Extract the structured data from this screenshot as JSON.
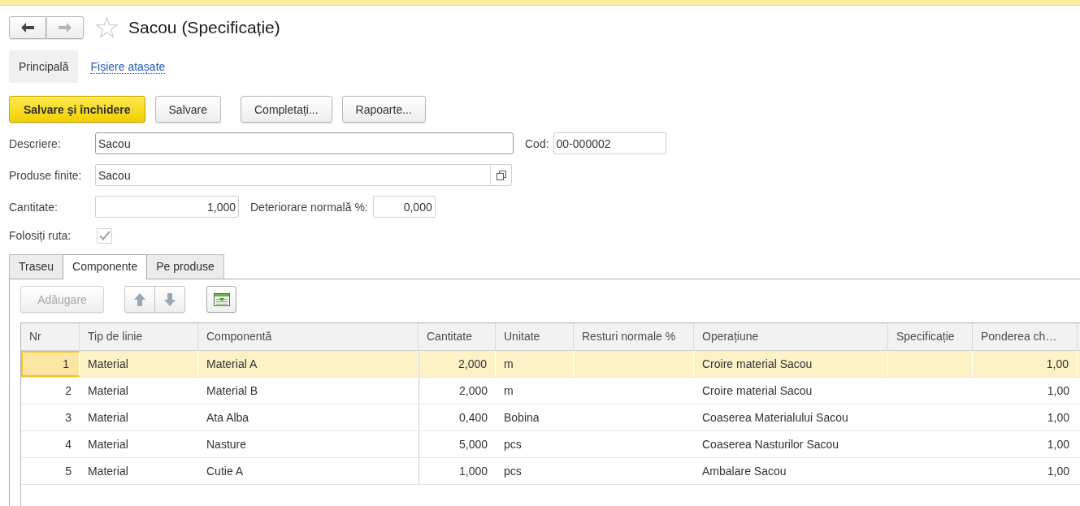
{
  "window": {
    "title": "Sacou (Specificație)",
    "favorite": false
  },
  "navigation": {
    "back": {
      "disabled": false
    },
    "forward": {
      "disabled": true
    }
  },
  "sections": [
    {
      "label": "Principală",
      "selected": true
    },
    {
      "label": "Fișiere atașate",
      "selected": false
    }
  ],
  "command_bar": [
    [
      {
        "label": "Salvare şi închidere",
        "kind": "default"
      },
      {
        "label": "Salvare",
        "kind": "normal"
      }
    ],
    [
      {
        "label": "Completați...",
        "kind": "normal"
      },
      {
        "label": "Rapoarte...",
        "kind": "normal"
      }
    ]
  ],
  "form": {
    "descriere": {
      "label": "Descriere:",
      "value": "Sacou"
    },
    "cod": {
      "label": "Cod:",
      "value": "00-000002"
    },
    "produse_finite": {
      "label": "Produse finite:",
      "value": "Sacou"
    },
    "cantitate": {
      "label": "Cantitate:",
      "value": "1,000"
    },
    "deteriorare": {
      "label": "Deteriorare normală %:",
      "value": "0,000"
    },
    "folositi_ruta": {
      "label": "Folosiți ruta:",
      "checked": true,
      "disabled": true
    }
  },
  "tabs": [
    {
      "label": "Traseu",
      "selected": false
    },
    {
      "label": "Componente",
      "selected": true
    },
    {
      "label": "Pe produse",
      "selected": false
    }
  ],
  "toolbar": {
    "add": {
      "label": "Adăugare",
      "disabled": true
    }
  },
  "table": {
    "columns": [
      "Nr",
      "Tip de linie",
      "Componentă",
      "Cantitate",
      "Unitate",
      "Resturi normale %",
      "Operațiune",
      "Specificație",
      "Ponderea ch…"
    ],
    "rows": [
      {
        "nr": "1",
        "tip_de_linie": "Material",
        "componenta": "Material A",
        "cantitate": "2,000",
        "unitate": "m",
        "operatiune": "Croire material Sacou",
        "ponderea": "1,00",
        "selected": true
      },
      {
        "nr": "2",
        "tip_de_linie": "Material",
        "componenta": "Material B",
        "cantitate": "2,000",
        "unitate": "m",
        "operatiune": "Croire material Sacou",
        "ponderea": "1,00",
        "selected": false
      },
      {
        "nr": "3",
        "tip_de_linie": "Material",
        "componenta": "Ata Alba",
        "cantitate": "0,400",
        "unitate": "Bobina",
        "operatiune": "Coaserea Materialului Sacou",
        "ponderea": "1,00",
        "selected": false
      },
      {
        "nr": "4",
        "tip_de_linie": "Material",
        "componenta": "Nasture",
        "cantitate": "5,000",
        "unitate": "pcs",
        "operatiune": "Coaserea Nasturilor Sacou",
        "ponderea": "1,00",
        "selected": false
      },
      {
        "nr": "5",
        "tip_de_linie": "Material",
        "componenta": "Cutie A",
        "cantitate": "1,000",
        "unitate": "pcs",
        "operatiune": "Ambalare Sacou",
        "ponderea": "1,00",
        "selected": false
      }
    ]
  }
}
